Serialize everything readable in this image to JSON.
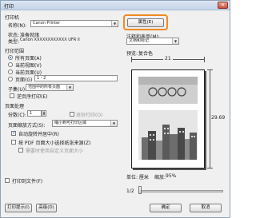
{
  "window": {
    "title": "打印"
  },
  "printer": {
    "section": "打印机",
    "name_label": "名称(N):",
    "name_value": "Canon Printer",
    "properties_button": "属性(E)",
    "status_label": "状态:",
    "status_value": "准备就绪",
    "type_label": "类型:",
    "type_value": "Canon XXXXXXXXXXXX UFR II"
  },
  "annotations": {
    "label": "注释和表单(M):",
    "value": "文档和标记"
  },
  "print_range": {
    "section": "打印范围",
    "options": [
      {
        "label": "所有页面(A)",
        "selected": true
      },
      {
        "label": "当前视图(V)",
        "selected": false
      },
      {
        "label": "当前页面(U)",
        "selected": false
      },
      {
        "label": "页面(G)",
        "selected": false
      }
    ],
    "pages_value": "1 - 2",
    "subset_label": "子集(U):",
    "subset_value": "范围中的所有页面",
    "reverse_label": "逆页序打印(E)"
  },
  "page_handling": {
    "section": "页面处理",
    "copies_label": "份数(C):",
    "copies_value": "1",
    "collate_label": "逐份打印(O)",
    "scaling_label": "页面缩放方式(S):",
    "scaling_value": "缩小到可打印区域",
    "auto_rotate_label": "自动旋转并居中(R)",
    "pdf_paper_label": "按 PDF 页面大小选择纸张来源(Z)",
    "custom_paper_label": "需要时使用自定义页面大小"
  },
  "print_to_file_label": "打印到文件(F)",
  "preview": {
    "label": "预览:",
    "value": "复合色",
    "width_value": "21",
    "height_value": "29.69",
    "units_label": "单位: 厘米",
    "zoom_label": "缩放:",
    "zoom_value": "95%",
    "page_indicator": "1/2"
  },
  "footer": {
    "tips_button": "打印提示(I)",
    "advanced_button": "高级(D)",
    "ok_button": "确定",
    "cancel_button": "取消"
  },
  "colors": {
    "highlight": "#f08a1f",
    "radio_dot": "#1c5fb0"
  }
}
